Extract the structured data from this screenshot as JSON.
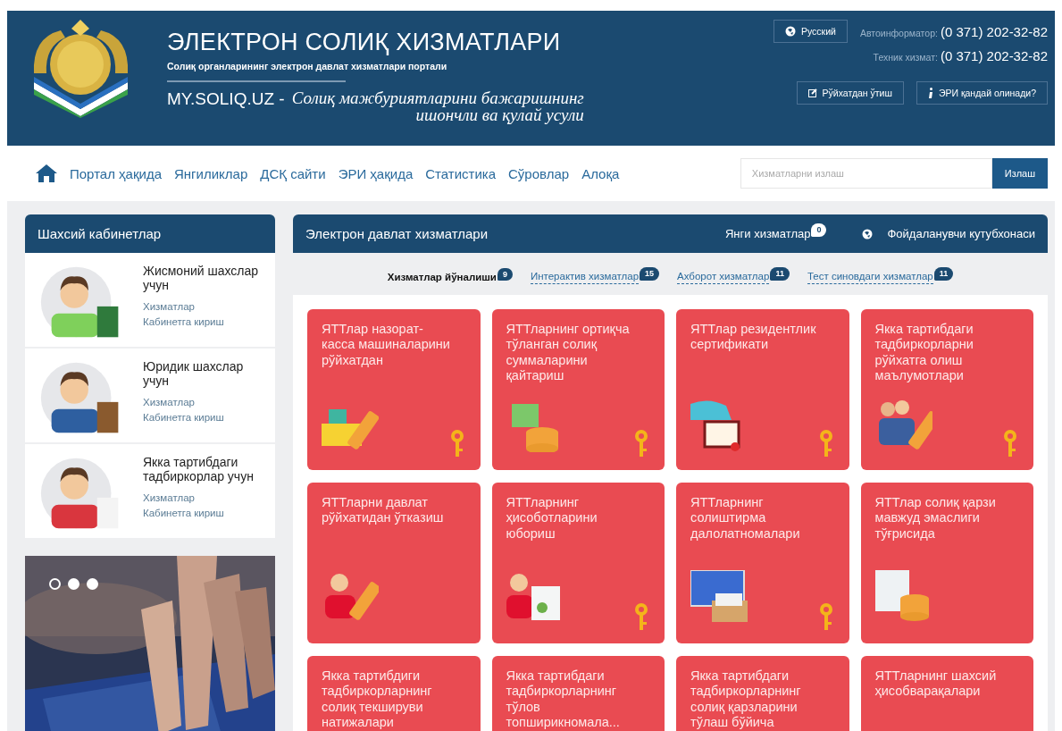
{
  "header": {
    "title": "ЭЛЕКТРОН СОЛИҚ ХИЗМАТЛАРИ",
    "subtitle": "Солиқ органларининг электрон давлат хизматлари портали",
    "site": "MY.SOLIQ.UZ -",
    "slogan": "Солиқ мажбуриятларини бажаришнинг\nишончли ва қулай усули",
    "language": "Русский",
    "contacts": [
      {
        "label": "Автоинформатор:",
        "value": "(0 371) 202-32-82"
      },
      {
        "label": "Техник хизмат:",
        "value": "(0 371) 202-32-82"
      }
    ],
    "buttons": [
      "Рўйхатдан ўтиш",
      "ЭРИ қандай олинади?"
    ]
  },
  "nav": {
    "links": [
      "Портал ҳақида",
      "Янгиликлар",
      "ДСҚ сайти",
      "ЭРИ ҳақида",
      "Статистика",
      "Сўровлар",
      "Алоқа"
    ],
    "search": {
      "placeholder": "Хизматларни излаш",
      "button": "Излаш"
    }
  },
  "sidebar": {
    "title": "Шахсий кабинетлар",
    "cabinets": [
      {
        "title": "Жисмоний шахслар учун",
        "links": [
          "Хизматлар",
          "Кабинетга кириш"
        ]
      },
      {
        "title": "Юридик шахслар учун",
        "links": [
          "Хизматлар",
          "Кабинетга кириш"
        ]
      },
      {
        "title": "Якка тартибдаги тадбиркорлар учун",
        "links": [
          "Хизматлар",
          "Кабинетга кириш"
        ]
      }
    ],
    "slides": [
      {
        "selected": true
      },
      {
        "selected": false
      },
      {
        "selected": false
      }
    ]
  },
  "services": {
    "title": "Электрон давлат хизматлари",
    "new_label": "Янги хизматлар",
    "new_count": "0",
    "library": "Фойдаланувчи кутубхонаси",
    "tabs": [
      {
        "label": "Хизматлар йўналиши",
        "count": "9",
        "selected": true
      },
      {
        "label": "Интерактив хизматлар",
        "count": "15",
        "selected": false
      },
      {
        "label": "Ахборот хизматлар",
        "count": "11",
        "selected": false
      },
      {
        "label": "Тест синовдаги хизматлар",
        "count": "11",
        "selected": false
      }
    ],
    "tiles": [
      {
        "title": "ЯТТлар назорат-касса машиналарини рўйхатдан",
        "key": true
      },
      {
        "title": "ЯТТларнинг ортиқча тўланган солиқ суммаларини қайтариш",
        "key": true
      },
      {
        "title": "ЯТТлар резидентлик сертификати",
        "key": true
      },
      {
        "title": "Якка тартибдаги тадбиркорларни рўйхатга олиш маълумотлари",
        "key": true
      },
      {
        "title": "ЯТТларни давлат рўйхатидан ўтказиш",
        "key": false
      },
      {
        "title": "ЯТТларнинг ҳисоботларини юбориш",
        "key": true
      },
      {
        "title": "ЯТТларнинг солиштирма далолатномалари",
        "key": true
      },
      {
        "title": "ЯТТлар солиқ қарзи мавжуд эмаслиги тўғрисида",
        "key": false
      },
      {
        "title": "Якка тартибдиги тадбиркорларнинг солиқ текшируви натижалари",
        "key": false
      },
      {
        "title": "Якка тартибдаги тадбиркорларнинг тўлов топширикномала...",
        "key": false
      },
      {
        "title": "Якка тартибдаги тадбиркорларнинг солиқ қарзларини тўлаш бўйича",
        "key": false
      },
      {
        "title": "ЯТТларнинг шахсий ҳисобварақалари",
        "key": false
      }
    ]
  }
}
